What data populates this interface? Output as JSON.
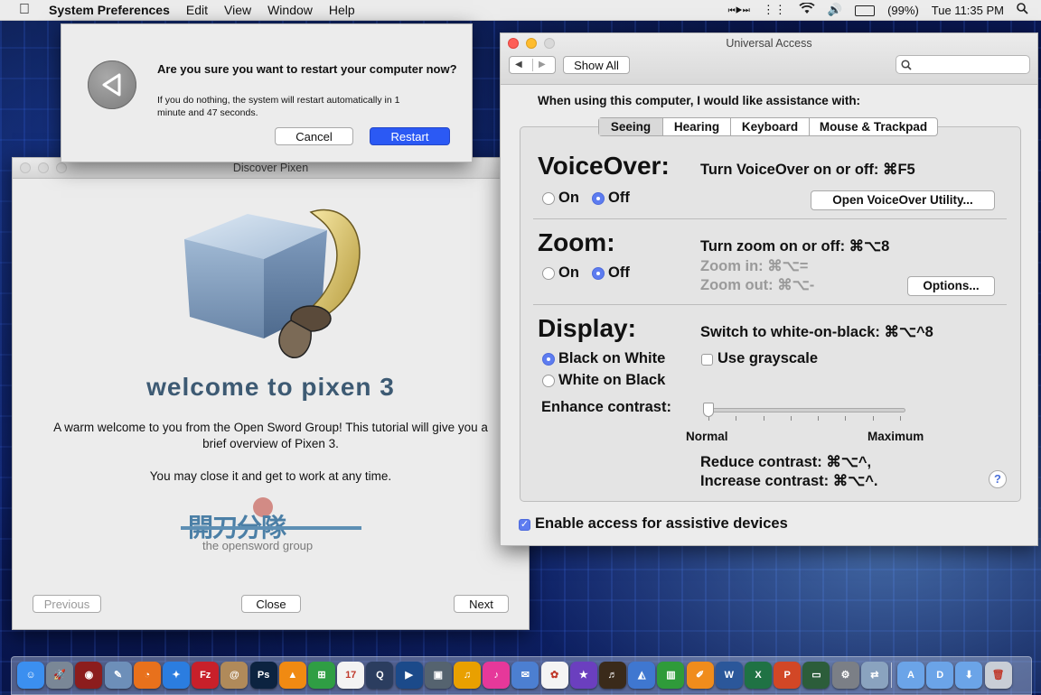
{
  "menubar": {
    "app_name": "System Preferences",
    "items": [
      "Edit",
      "View",
      "Window",
      "Help"
    ],
    "status": {
      "media": "⏮▶⏭",
      "battery": "(99%)",
      "time": "Tue 11:35 PM"
    }
  },
  "restart_dialog": {
    "question": "Are you sure you want to restart your computer now?",
    "message_line1": "If you do nothing, the system will restart automatically in 1",
    "message_line2": "minute and 47 seconds.",
    "cancel_label": "Cancel",
    "restart_label": "Restart"
  },
  "pixen": {
    "window_title": "Discover Pixen",
    "welcome_title": "welcome to pixen 3",
    "intro_line1": "A warm welcome to you from the Open Sword Group! This tutorial will give you a",
    "intro_line2": "brief overview of Pixen 3.",
    "close_note": "You may close it and get to work at any time.",
    "logo_cjk": "開刀分隊",
    "logo_text": "the opensword group",
    "previous_label": "Previous",
    "close_label": "Close",
    "next_label": "Next"
  },
  "universal_access": {
    "window_title": "Universal Access",
    "show_all_label": "Show All",
    "search_placeholder": "",
    "prompt": "When using this computer, I would like assistance with:",
    "tabs": [
      "Seeing",
      "Hearing",
      "Keyboard",
      "Mouse & Trackpad"
    ],
    "selected_tab": "Seeing",
    "voiceover": {
      "heading": "VoiceOver:",
      "shortcut": "Turn VoiceOver on or off: ⌘F5",
      "on_label": "On",
      "off_label": "Off",
      "utility_button": "Open VoiceOver Utility..."
    },
    "zoom": {
      "heading": "Zoom:",
      "shortcut": "Turn zoom on or off: ⌘⌥8",
      "zoom_in": "Zoom in: ⌘⌥=",
      "zoom_out": "Zoom out: ⌘⌥-",
      "on_label": "On",
      "off_label": "Off",
      "options_button": "Options..."
    },
    "display": {
      "heading": "Display:",
      "shortcut": "Switch to white-on-black: ⌘⌥^8",
      "black_on_white": "Black on White",
      "white_on_black": "White on Black",
      "grayscale": "Use grayscale",
      "enhance_label": "Enhance contrast:",
      "slider_min": "Normal",
      "slider_max": "Maximum",
      "slider_value": 0,
      "reduce": "Reduce contrast: ⌘⌥^,",
      "increase": "Increase contrast: ⌘⌥^."
    },
    "help_glyph": "?",
    "assistive_label": "Enable access for assistive devices"
  },
  "dock": {
    "items": [
      {
        "name": "finder",
        "glyph": "☺",
        "color": "#3b8ff0"
      },
      {
        "name": "launchpad",
        "glyph": "🚀",
        "color": "#7a8796"
      },
      {
        "name": "photo-booth",
        "glyph": "◉",
        "color": "#8c1d1d"
      },
      {
        "name": "preview",
        "glyph": "✎",
        "color": "#6d8fb9"
      },
      {
        "name": "firefox",
        "glyph": "◔",
        "color": "#e8711c"
      },
      {
        "name": "safari",
        "glyph": "✦",
        "color": "#2b7de0"
      },
      {
        "name": "filezilla",
        "glyph": "Fz",
        "color": "#c8202a"
      },
      {
        "name": "contacts",
        "glyph": "@",
        "color": "#b08a5a"
      },
      {
        "name": "photoshop",
        "glyph": "Ps",
        "color": "#0c2340"
      },
      {
        "name": "vlc",
        "glyph": "▲",
        "color": "#f08a12"
      },
      {
        "name": "windows",
        "glyph": "⊞",
        "color": "#2f9e44"
      },
      {
        "name": "calendar",
        "glyph": "17",
        "color": "#f3f3f3"
      },
      {
        "name": "quicktime",
        "glyph": "Q",
        "color": "#2b3d5f"
      },
      {
        "name": "dvd-player",
        "glyph": "▶",
        "color": "#1b4a8a"
      },
      {
        "name": "image-capture",
        "glyph": "▣",
        "color": "#55636f"
      },
      {
        "name": "audio",
        "glyph": "♫",
        "color": "#e9a000"
      },
      {
        "name": "itunes",
        "glyph": "♪",
        "color": "#e6389a"
      },
      {
        "name": "mail",
        "glyph": "✉",
        "color": "#4c7fd1"
      },
      {
        "name": "photos",
        "glyph": "✿",
        "color": "#f4f4f4"
      },
      {
        "name": "imovie",
        "glyph": "★",
        "color": "#6b3fbf"
      },
      {
        "name": "garageband",
        "glyph": "♬",
        "color": "#3a2a1a"
      },
      {
        "name": "keynote",
        "glyph": "◭",
        "color": "#3f77d0"
      },
      {
        "name": "numbers",
        "glyph": "▥",
        "color": "#2f9b3a"
      },
      {
        "name": "pages",
        "glyph": "✐",
        "color": "#f08c1c"
      },
      {
        "name": "word",
        "glyph": "W",
        "color": "#2b579a"
      },
      {
        "name": "excel",
        "glyph": "X",
        "color": "#1f7244"
      },
      {
        "name": "powerpoint",
        "glyph": "P",
        "color": "#d24726"
      },
      {
        "name": "screen-sharing",
        "glyph": "▭",
        "color": "#2c5d3a"
      },
      {
        "name": "system-preferences",
        "glyph": "⚙",
        "color": "#7b7f86"
      },
      {
        "name": "migration",
        "glyph": "⇄",
        "color": "#8aa3bf"
      },
      {
        "name": "applications-folder",
        "glyph": "A",
        "color": "#6ba4e8"
      },
      {
        "name": "documents-folder",
        "glyph": "D",
        "color": "#6ba4e8"
      },
      {
        "name": "downloads-folder",
        "glyph": "⬇",
        "color": "#6ba4e8"
      },
      {
        "name": "trash",
        "glyph": "🗑",
        "color": "#c9ced6"
      }
    ]
  }
}
